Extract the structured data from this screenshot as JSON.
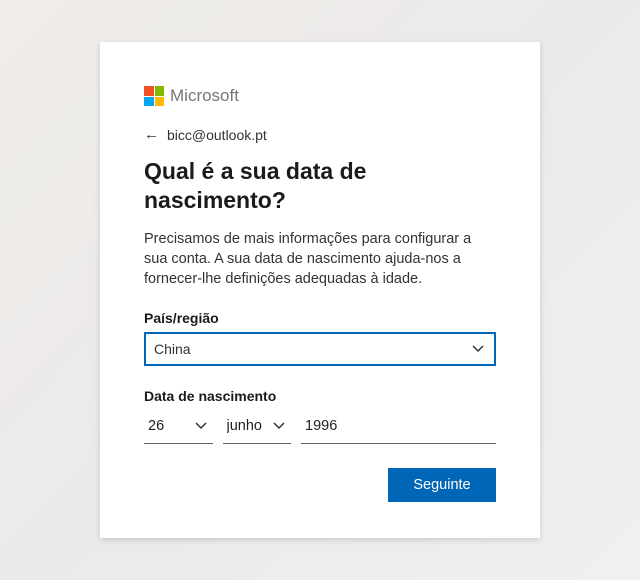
{
  "brand": "Microsoft",
  "identity": {
    "email": "bicc@outlook.pt"
  },
  "title": "Qual é a sua data de nascimento?",
  "description": "Precisamos de mais informações para configurar a sua conta. A sua data de nascimento ajuda-nos a fornecer-lhe definições adequadas à idade.",
  "fields": {
    "country": {
      "label": "País/região",
      "value": "China"
    },
    "dob": {
      "label": "Data de nascimento",
      "day": "26",
      "month": "junho",
      "year": "1996"
    }
  },
  "buttons": {
    "next": "Seguinte"
  }
}
